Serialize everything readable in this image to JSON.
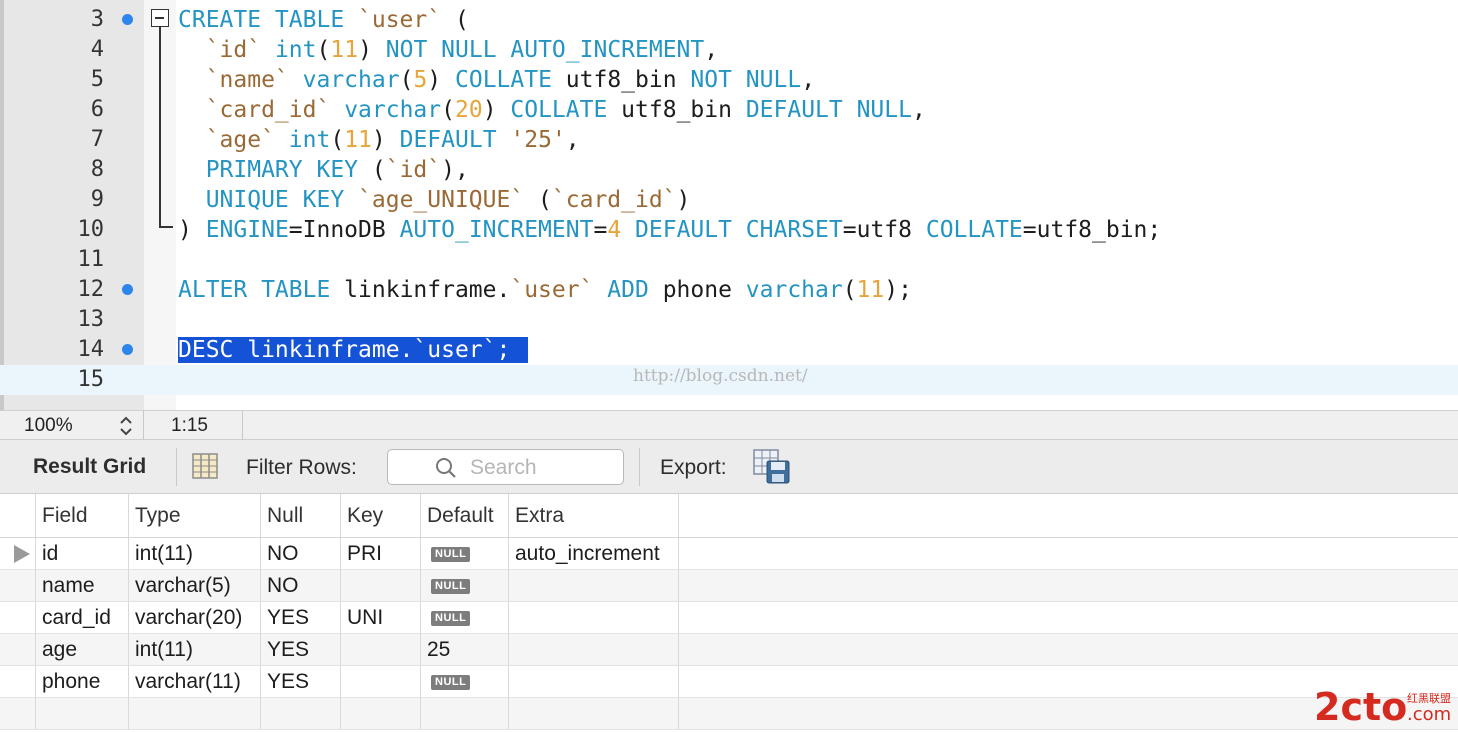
{
  "editor": {
    "lines": [
      {
        "number": "3",
        "breakpoint": true,
        "fold": true,
        "tokens": [
          [
            "kw",
            "CREATE TABLE "
          ],
          [
            "str",
            "`user`"
          ],
          [
            "id",
            " ("
          ]
        ]
      },
      {
        "number": "4",
        "tokens": [
          [
            "str",
            "  `id`"
          ],
          [
            "id",
            " "
          ],
          [
            "kw",
            "int"
          ],
          [
            "id",
            "("
          ],
          [
            "num",
            "11"
          ],
          [
            "id",
            ") "
          ],
          [
            "kw",
            "NOT NULL AUTO_INCREMENT"
          ],
          [
            "id",
            ","
          ]
        ]
      },
      {
        "number": "5",
        "tokens": [
          [
            "str",
            "  `name`"
          ],
          [
            "id",
            " "
          ],
          [
            "kw",
            "varchar"
          ],
          [
            "id",
            "("
          ],
          [
            "num",
            "5"
          ],
          [
            "id",
            ") "
          ],
          [
            "kw",
            "COLLATE"
          ],
          [
            "id",
            " utf8_bin "
          ],
          [
            "kw",
            "NOT NULL"
          ],
          [
            "id",
            ","
          ]
        ]
      },
      {
        "number": "6",
        "tokens": [
          [
            "str",
            "  `card_id`"
          ],
          [
            "id",
            " "
          ],
          [
            "kw",
            "varchar"
          ],
          [
            "id",
            "("
          ],
          [
            "num",
            "20"
          ],
          [
            "id",
            ") "
          ],
          [
            "kw",
            "COLLATE"
          ],
          [
            "id",
            " utf8_bin "
          ],
          [
            "kw",
            "DEFAULT NULL"
          ],
          [
            "id",
            ","
          ]
        ]
      },
      {
        "number": "7",
        "tokens": [
          [
            "str",
            "  `age`"
          ],
          [
            "id",
            " "
          ],
          [
            "kw",
            "int"
          ],
          [
            "id",
            "("
          ],
          [
            "num",
            "11"
          ],
          [
            "id",
            ") "
          ],
          [
            "kw",
            "DEFAULT"
          ],
          [
            "id",
            " "
          ],
          [
            "str",
            "'25'"
          ],
          [
            "id",
            ","
          ]
        ]
      },
      {
        "number": "8",
        "tokens": [
          [
            "kw",
            "  PRIMARY KEY"
          ],
          [
            "id",
            " ("
          ],
          [
            "str",
            "`id`"
          ],
          [
            "id",
            "),"
          ]
        ]
      },
      {
        "number": "9",
        "tokens": [
          [
            "kw",
            "  UNIQUE KEY"
          ],
          [
            "id",
            " "
          ],
          [
            "str",
            "`age_UNIQUE`"
          ],
          [
            "id",
            " ("
          ],
          [
            "str",
            "`card_id`"
          ],
          [
            "id",
            ")"
          ]
        ]
      },
      {
        "number": "10",
        "tokens": [
          [
            "id",
            ") "
          ],
          [
            "kw",
            "ENGINE"
          ],
          [
            "id",
            "=InnoDB "
          ],
          [
            "kw",
            "AUTO_INCREMENT"
          ],
          [
            "id",
            "="
          ],
          [
            "num",
            "4"
          ],
          [
            "id",
            " "
          ],
          [
            "kw",
            "DEFAULT CHARSET"
          ],
          [
            "id",
            "=utf8 "
          ],
          [
            "kw",
            "COLLATE"
          ],
          [
            "id",
            "=utf8_bin;"
          ]
        ]
      },
      {
        "number": "11",
        "tokens": []
      },
      {
        "number": "12",
        "breakpoint": true,
        "tokens": [
          [
            "kw",
            "ALTER TABLE"
          ],
          [
            "id",
            " linkinframe."
          ],
          [
            "str",
            "`user`"
          ],
          [
            "id",
            " "
          ],
          [
            "kw",
            "ADD"
          ],
          [
            "id",
            " phone "
          ],
          [
            "kw",
            "varchar"
          ],
          [
            "id",
            "("
          ],
          [
            "num",
            "11"
          ],
          [
            "id",
            ");"
          ]
        ]
      },
      {
        "number": "13",
        "tokens": []
      },
      {
        "number": "14",
        "breakpoint": true,
        "selected": true,
        "tokens": [
          [
            "kw",
            "DESC"
          ],
          [
            "id",
            " linkinframe."
          ],
          [
            "str",
            "`user`"
          ],
          [
            "id",
            ";"
          ]
        ]
      },
      {
        "number": "15",
        "current": true,
        "tokens": []
      }
    ],
    "watermark": "http://blog.csdn.net/"
  },
  "statusbar": {
    "zoom": "100%",
    "cursor": "1:15"
  },
  "result_toolbar": {
    "title": "Result Grid",
    "filter_label": "Filter Rows:",
    "search_placeholder": "Search",
    "export_label": "Export:"
  },
  "grid": {
    "columns": [
      "Field",
      "Type",
      "Null",
      "Key",
      "Default",
      "Extra"
    ],
    "null_badge": "NULL",
    "rows": [
      {
        "field": "id",
        "type": "int(11)",
        "null": "NO",
        "key": "PRI",
        "default_null": true,
        "default": "",
        "extra": "auto_increment"
      },
      {
        "field": "name",
        "type": "varchar(5)",
        "null": "NO",
        "key": "",
        "default_null": true,
        "default": "",
        "extra": ""
      },
      {
        "field": "card_id",
        "type": "varchar(20)",
        "null": "YES",
        "key": "UNI",
        "default_null": true,
        "default": "",
        "extra": ""
      },
      {
        "field": "age",
        "type": "int(11)",
        "null": "YES",
        "key": "",
        "default_null": false,
        "default": "25",
        "extra": ""
      },
      {
        "field": "phone",
        "type": "varchar(11)",
        "null": "YES",
        "key": "",
        "default_null": true,
        "default": "",
        "extra": ""
      }
    ]
  },
  "logo": {
    "brand": "2cto",
    "suffix": ".com",
    "tag": "红黑联盟"
  },
  "colors": {
    "keyword": "#2494c2",
    "string": "#9a6a36",
    "number": "#e8a43a",
    "selection": "#1553d6",
    "breakpoint": "#2f86ea",
    "logo_red": "#d42a1f"
  }
}
